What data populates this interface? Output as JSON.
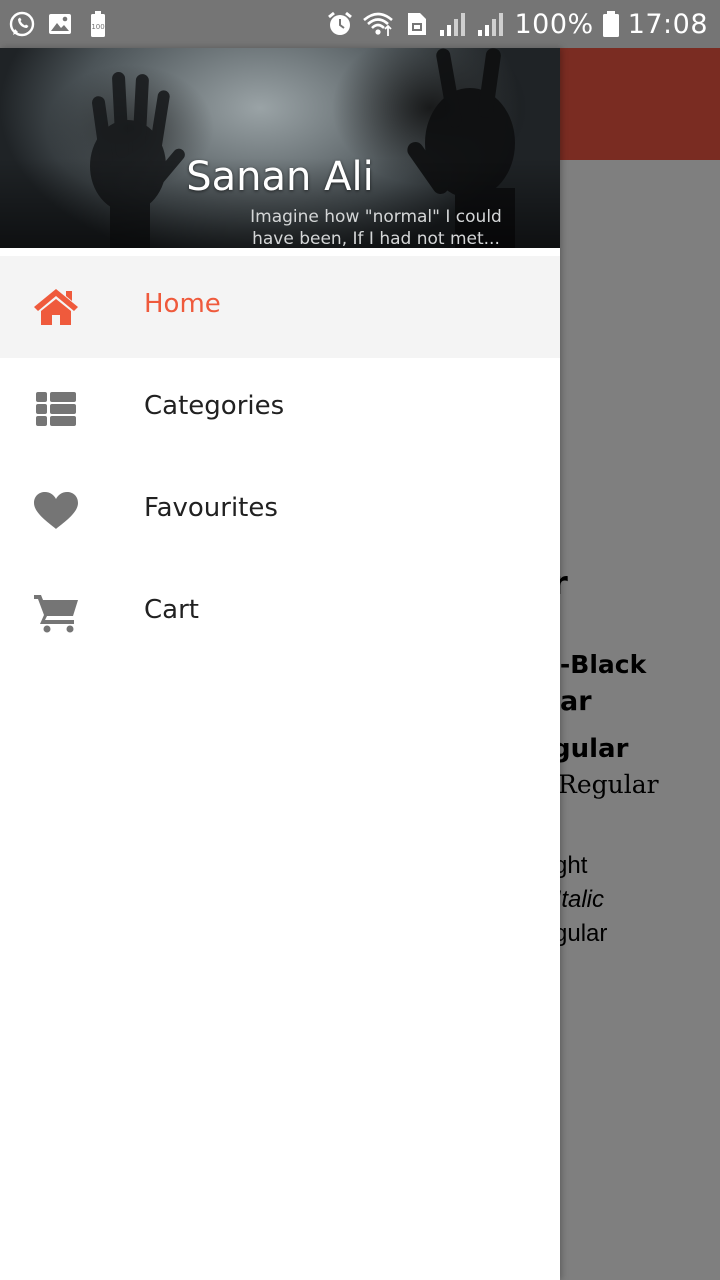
{
  "status_bar": {
    "battery_percent": "100%",
    "time": "17:08",
    "left_icons": [
      "whatsapp-icon",
      "gallery-icon",
      "battery-saver-icon"
    ],
    "right_icons": [
      "alarm-icon",
      "wifi-icon",
      "sim-icon",
      "signal-icon",
      "signal-icon",
      "battery-icon"
    ]
  },
  "drawer": {
    "header": {
      "name": "Sanan Ali",
      "quote_line1": "Imagine how \"normal\" I could",
      "quote_line2": "have been, If I had not met..."
    },
    "items": [
      {
        "label": "Home",
        "icon": "home-icon",
        "active": true
      },
      {
        "label": "Categories",
        "icon": "list-icon",
        "active": false
      },
      {
        "label": "Favourites",
        "icon": "heart-icon",
        "active": false
      },
      {
        "label": "Cart",
        "icon": "cart-icon",
        "active": false
      }
    ],
    "active_color": "#ef5a3c",
    "icon_color": "#757575"
  },
  "background": {
    "toolbar_color": "#7a2c22",
    "scrim_color": "#7f7f7f",
    "lines": [
      "r",
      "d-Black",
      "ar",
      "gular",
      "Regular",
      "ght",
      "tItalic",
      "gular"
    ]
  }
}
